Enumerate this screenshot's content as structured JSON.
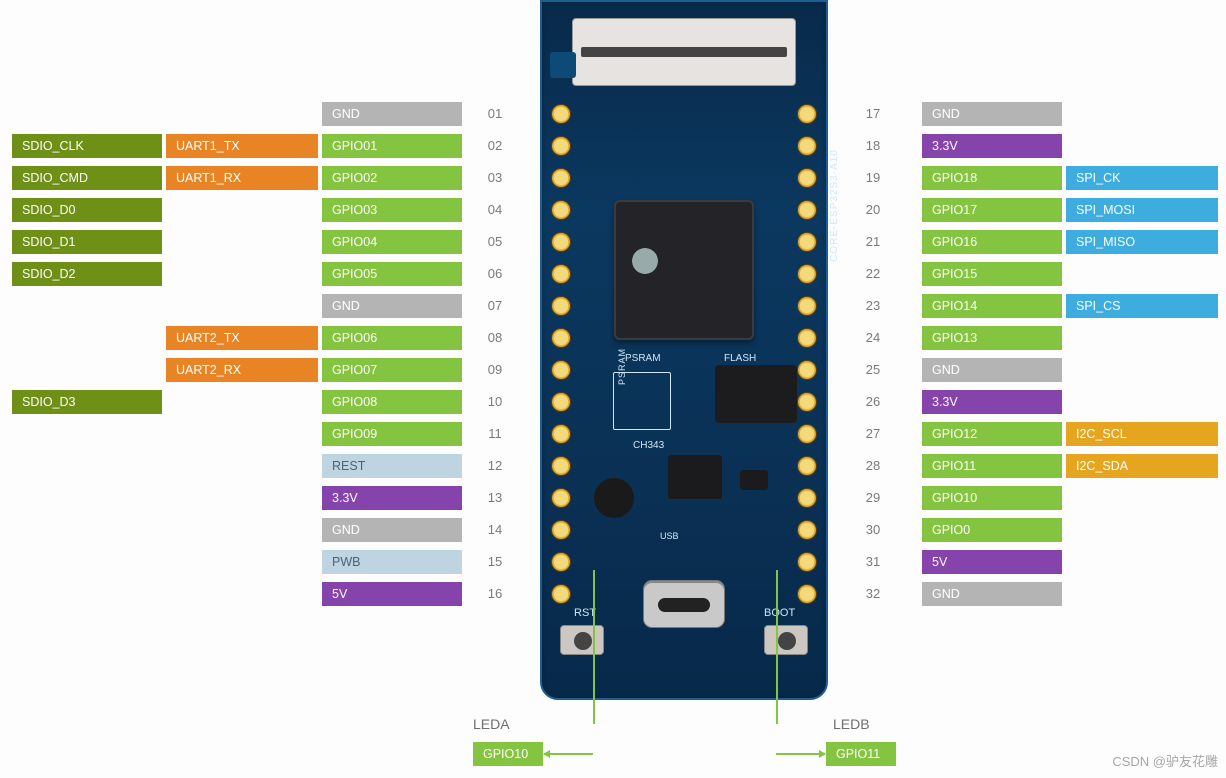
{
  "board": {
    "model_label": "CORE-ESP32S3-A10",
    "psram_label": "PSRAM",
    "flash_label": "FLASH",
    "ch_label": "CH343",
    "usb_label": "USB",
    "rst_label": "RST",
    "boot_label": "BOOT"
  },
  "leds": {
    "left": {
      "name": "LEDA",
      "gpio": "GPIO10"
    },
    "right": {
      "name": "LEDB",
      "gpio": "GPIO11"
    }
  },
  "watermark": "CSDN @驴友花雕",
  "left_pins": [
    {
      "num": "01",
      "col1": "",
      "col2": "",
      "col3": "GND",
      "c3_color": "gray"
    },
    {
      "num": "02",
      "col1": "SDIO_CLK",
      "col2": "UART1_TX",
      "col3": "GPIO01",
      "c1_color": "olive",
      "c2_color": "orange",
      "c3_color": "lime"
    },
    {
      "num": "03",
      "col1": "SDIO_CMD",
      "col2": "UART1_RX",
      "col3": "GPIO02",
      "c1_color": "olive",
      "c2_color": "orange",
      "c3_color": "lime"
    },
    {
      "num": "04",
      "col1": "SDIO_D0",
      "col2": "",
      "col3": "GPIO03",
      "c1_color": "olive",
      "c3_color": "lime"
    },
    {
      "num": "05",
      "col1": "SDIO_D1",
      "col2": "",
      "col3": "GPIO04",
      "c1_color": "olive",
      "c3_color": "lime"
    },
    {
      "num": "06",
      "col1": "SDIO_D2",
      "col2": "",
      "col3": "GPIO05",
      "c1_color": "olive",
      "c3_color": "lime"
    },
    {
      "num": "07",
      "col1": "",
      "col2": "",
      "col3": "GND",
      "c3_color": "gray"
    },
    {
      "num": "08",
      "col1": "",
      "col2": "UART2_TX",
      "col3": "GPIO06",
      "c2_color": "orange",
      "c3_color": "lime"
    },
    {
      "num": "09",
      "col1": "",
      "col2": "UART2_RX",
      "col3": "GPIO07",
      "c2_color": "orange",
      "c3_color": "lime"
    },
    {
      "num": "10",
      "col1": "SDIO_D3",
      "col2": "",
      "col3": "GPIO08",
      "c1_color": "olive",
      "c3_color": "lime"
    },
    {
      "num": "11",
      "col1": "",
      "col2": "",
      "col3": "GPIO09",
      "c3_color": "lime"
    },
    {
      "num": "12",
      "col1": "",
      "col2": "",
      "col3": "REST",
      "c3_color": "blue"
    },
    {
      "num": "13",
      "col1": "",
      "col2": "",
      "col3": "3.3V",
      "c3_color": "purple"
    },
    {
      "num": "14",
      "col1": "",
      "col2": "",
      "col3": "GND",
      "c3_color": "gray"
    },
    {
      "num": "15",
      "col1": "",
      "col2": "",
      "col3": "PWB",
      "c3_color": "blue"
    },
    {
      "num": "16",
      "col1": "",
      "col2": "",
      "col3": "5V",
      "c3_color": "purple"
    }
  ],
  "right_pins": [
    {
      "num": "17",
      "col1": "GND",
      "col2": "",
      "c1_color": "gray"
    },
    {
      "num": "18",
      "col1": "3.3V",
      "col2": "",
      "c1_color": "purple"
    },
    {
      "num": "19",
      "col1": "GPIO18",
      "col2": "SPI_CK",
      "c1_color": "lime",
      "c2_color": "cyan"
    },
    {
      "num": "20",
      "col1": "GPIO17",
      "col2": "SPI_MOSI",
      "c1_color": "lime",
      "c2_color": "cyan"
    },
    {
      "num": "21",
      "col1": "GPIO16",
      "col2": "SPI_MISO",
      "c1_color": "lime",
      "c2_color": "cyan"
    },
    {
      "num": "22",
      "col1": "GPIO15",
      "col2": "",
      "c1_color": "lime"
    },
    {
      "num": "23",
      "col1": "GPIO14",
      "col2": "SPI_CS",
      "c1_color": "lime",
      "c2_color": "cyan"
    },
    {
      "num": "24",
      "col1": "GPIO13",
      "col2": "",
      "c1_color": "lime"
    },
    {
      "num": "25",
      "col1": "GND",
      "col2": "",
      "c1_color": "gray"
    },
    {
      "num": "26",
      "col1": "3.3V",
      "col2": "",
      "c1_color": "purple"
    },
    {
      "num": "27",
      "col1": "GPIO12",
      "col2": "I2C_SCL",
      "c1_color": "lime",
      "c2_color": "amber"
    },
    {
      "num": "28",
      "col1": "GPIO11",
      "col2": "I2C_SDA",
      "c1_color": "lime",
      "c2_color": "amber"
    },
    {
      "num": "29",
      "col1": "GPIO10",
      "col2": "",
      "c1_color": "lime"
    },
    {
      "num": "30",
      "col1": "GPIO0",
      "col2": "",
      "c1_color": "lime"
    },
    {
      "num": "31",
      "col1": "5V",
      "col2": "",
      "c1_color": "purple"
    },
    {
      "num": "32",
      "col1": "GND",
      "col2": "",
      "c1_color": "gray"
    }
  ]
}
